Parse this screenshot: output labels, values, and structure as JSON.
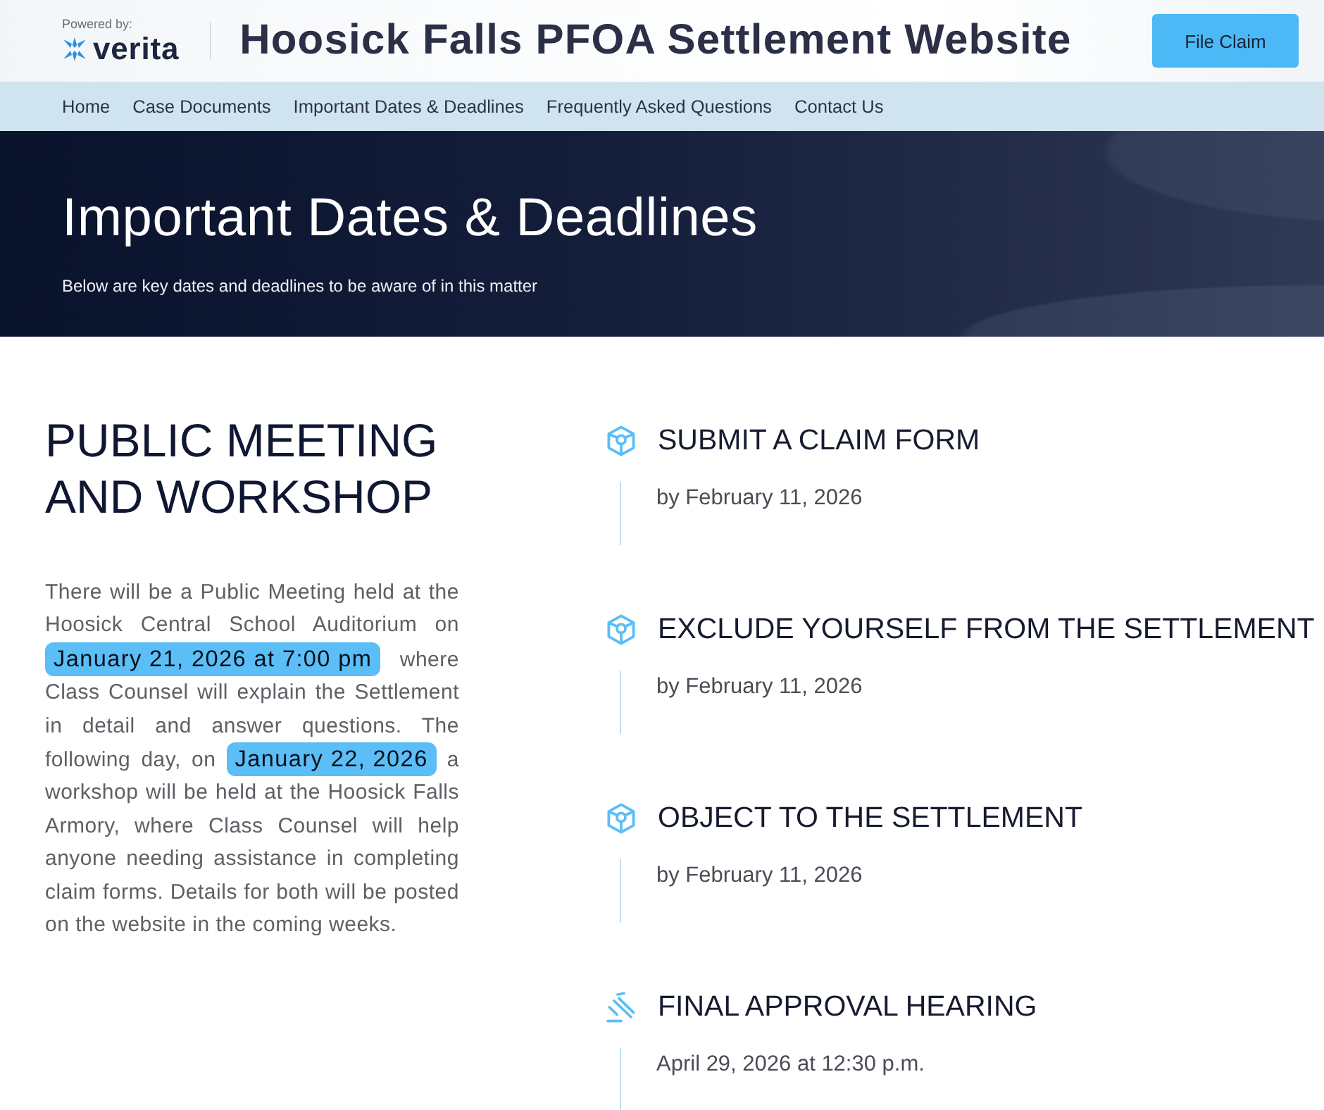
{
  "header": {
    "powered_by": "Powered by:",
    "brand": "verita",
    "site_title": "Hoosick Falls PFOA Settlement Website",
    "cta_button": "File Claim"
  },
  "nav": [
    "Home",
    "Case Documents",
    "Important Dates & Deadlines",
    "Frequently Asked Questions",
    "Contact Us"
  ],
  "hero": {
    "title": "Important Dates & Deadlines",
    "subtitle": "Below are key dates and deadlines to be aware of in this matter"
  },
  "meeting": {
    "title": "PUBLIC MEETING AND WORKSHOP",
    "paragraph": [
      {
        "text": "There will be a Public Meeting held at the Hoosick Central School Auditorium on ",
        "highlighted": false
      },
      {
        "text": "January 21, 2026 at 7:00 pm",
        "highlighted": true
      },
      {
        "text": " where Class Counsel will explain the Settlement in detail and answer questions. The following day, on ",
        "highlighted": false
      },
      {
        "text": "January 22, 2026",
        "highlighted": true
      },
      {
        "text": " a workshop will be held at the Hoosick Falls Armory, where Class Counsel will help anyone needing assistance in completing claim forms. Details for both will be posted on the website in the coming weeks.",
        "highlighted": false
      }
    ]
  },
  "timeline": [
    {
      "kind": "deadline",
      "title": "SUBMIT A CLAIM FORM",
      "date": "by February 11, 2026"
    },
    {
      "kind": "deadline",
      "title": "EXCLUDE YOURSELF FROM THE SETTLEMENT",
      "date": "by February 11, 2026"
    },
    {
      "kind": "deadline",
      "title": "OBJECT TO THE SETTLEMENT",
      "date": "by February 11, 2026"
    },
    {
      "kind": "hearing",
      "title": "FINAL APPROVAL HEARING",
      "date": "April 29, 2026 at 12:30 p.m."
    }
  ]
}
